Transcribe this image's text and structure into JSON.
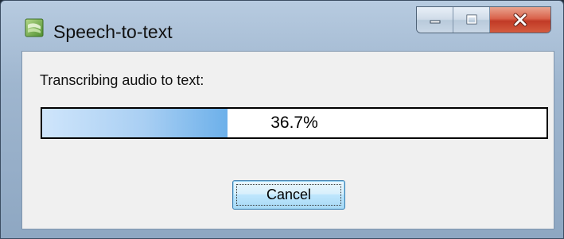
{
  "window": {
    "title": "Speech-to-text",
    "icon": "speech-app-icon",
    "caption_buttons": [
      "minimize-icon",
      "maximize-icon",
      "close-icon"
    ]
  },
  "dialog": {
    "label": "Transcribing audio to text:",
    "progress": {
      "value_fraction": 0.367,
      "text": "36.7%"
    },
    "cancel_label": "Cancel"
  },
  "colors": {
    "progress_fill": "#a9cff3",
    "close_button": "#c13a26",
    "client_background": "#f0f0f0"
  }
}
